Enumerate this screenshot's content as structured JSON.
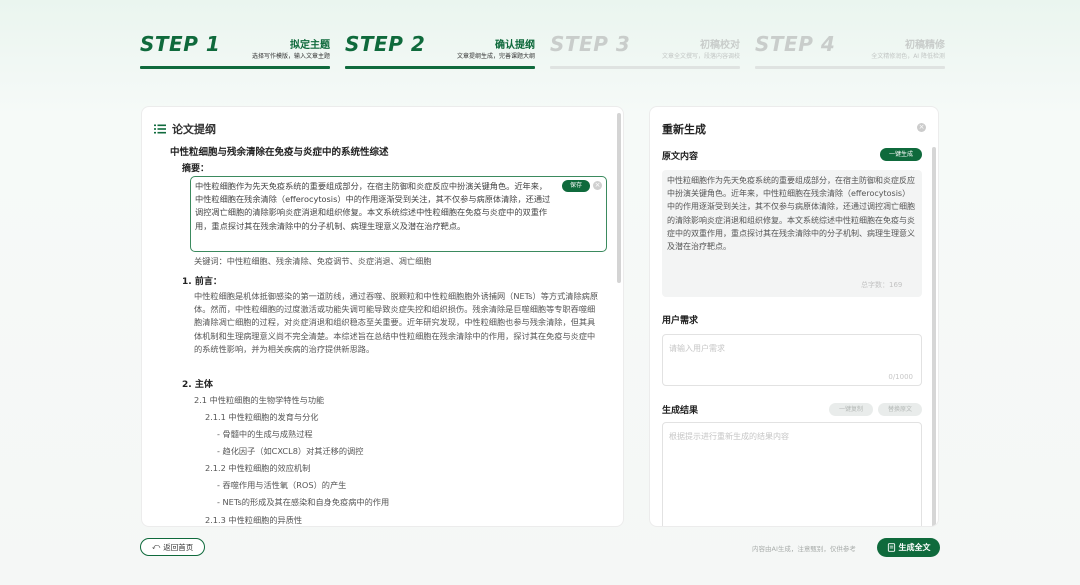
{
  "steps": [
    {
      "num": "STEP 1",
      "title": "拟定主题",
      "desc": "选择写作模版，输入文章主题",
      "state": "active"
    },
    {
      "num": "STEP 2",
      "title": "确认提纲",
      "desc": "文章提纲生成，完善课题大纲",
      "state": "active"
    },
    {
      "num": "STEP 3",
      "title": "初稿校对",
      "desc": "文章全文撰写，段落内容调校",
      "state": "inactive"
    },
    {
      "num": "STEP 4",
      "title": "初稿精修",
      "desc": "全文精修润色，AI 降低检测",
      "state": "inactive"
    }
  ],
  "outline": {
    "header": "论文提纲",
    "paper_title": "中性粒细胞与残余清除在免疫与炎症中的系统性综述",
    "abstract_label": "摘要：",
    "abstract_text": "中性粒细胞作为先天免疫系统的重要组成部分，在宿主防御和炎症反应中扮演关键角色。近年来，中性粒细胞在残余清除（efferocytosis）中的作用逐渐受到关注，其不仅参与病原体清除，还通过调控凋亡细胞的清除影响炎症消退和组织修复。本文系统综述中性粒细胞在免疫与炎症中的双重作用，重点探讨其在残余清除中的分子机制、病理生理意义及潜在治疗靶点。",
    "save_label": "保存",
    "keywords": "关键词：中性粒细胞、残余清除、免疫调节、炎症消退、凋亡细胞",
    "sec1_title": "1. 前言：",
    "sec1_text": "中性粒细胞是机体抵御感染的第一道防线，通过吞噬、脱颗粒和中性粒细胞胞外诱捕网（NETs）等方式清除病原体。然而，中性粒细胞的过度激活或功能失调可能导致炎症失控和组织损伤。残余清除是巨噬细胞等专职吞噬细胞清除凋亡细胞的过程，对炎症消退和组织稳态至关重要。近年研究发现，中性粒细胞也参与残余清除，但其具体机制和生理病理意义尚不完全清楚。本综述旨在总结中性粒细胞在残余清除中的作用，探讨其在免疫与炎症中的系统性影响，并为相关疾病的治疗提供新思路。",
    "sec2_title": "2. 主体",
    "items": [
      "2.1 中性粒细胞的生物学特性与功能",
      "2.1.1 中性粒细胞的发育与分化",
      "- 骨髓中的生成与成熟过程",
      "- 趋化因子（如CXCL8）对其迁移的调控",
      "2.1.2 中性粒细胞的效应机制",
      "- 吞噬作用与活性氧（ROS）的产生",
      "- NETs的形成及其在感染和自身免疫病中的作用",
      "2.1.3 中性粒细胞的异质性"
    ]
  },
  "regen": {
    "title": "重新生成",
    "orig_label": "原文内容",
    "expand_label": "一键生成",
    "orig_text": "中性粒细胞作为先天免疫系统的重要组成部分，在宿主防御和炎症反应中扮演关键角色。近年来，中性粒细胞在残余清除（efferocytosis）中的作用逐渐受到关注，其不仅参与病原体清除，还通过调控凋亡细胞的清除影响炎症消退和组织修复。本文系统综述中性粒细胞在免疫与炎症中的双重作用，重点探讨其在残余清除中的分子机制、病理生理意义及潜在治疗靶点。",
    "orig_count": "总字数：169",
    "user_label": "用户需求",
    "user_placeholder": "请输入用户需求",
    "user_count": "0/1000",
    "result_label": "生成结果",
    "copy_label": "一键复制",
    "replace_label": "替换原文",
    "result_placeholder": "根据提示进行重新生成的结果内容"
  },
  "footer": {
    "back_label": "返回首页",
    "disclaimer": "内容由AI生成，注意甄别，仅供参考",
    "generate_label": "生成全文"
  },
  "colors": {
    "accent": "#0f6a3c",
    "inactive": "#c9cdcb"
  }
}
